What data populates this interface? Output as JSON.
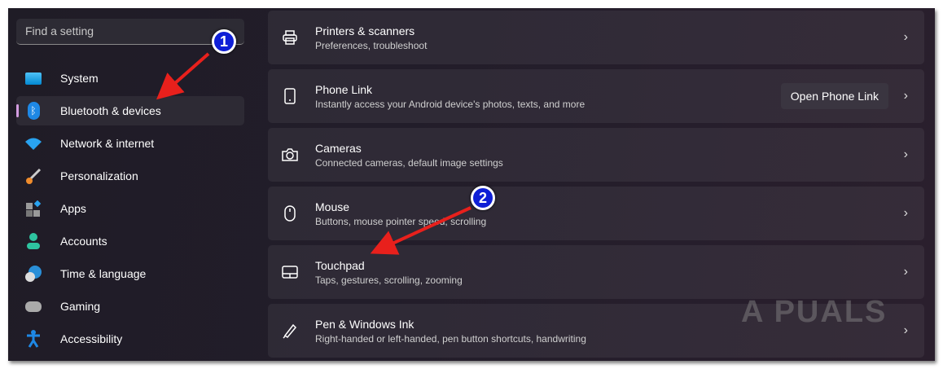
{
  "search": {
    "placeholder": "Find a setting"
  },
  "sidebar": {
    "items": [
      {
        "label": "System",
        "icon": "system-icon"
      },
      {
        "label": "Bluetooth & devices",
        "icon": "bluetooth-icon",
        "selected": true
      },
      {
        "label": "Network & internet",
        "icon": "wifi-icon"
      },
      {
        "label": "Personalization",
        "icon": "brush-icon"
      },
      {
        "label": "Apps",
        "icon": "apps-icon"
      },
      {
        "label": "Accounts",
        "icon": "person-icon"
      },
      {
        "label": "Time & language",
        "icon": "globe-clock-icon"
      },
      {
        "label": "Gaming",
        "icon": "gamepad-icon"
      },
      {
        "label": "Accessibility",
        "icon": "accessibility-icon"
      }
    ]
  },
  "cards": [
    {
      "title": "Printers & scanners",
      "subtitle": "Preferences, troubleshoot",
      "icon": "printer-icon"
    },
    {
      "title": "Phone Link",
      "subtitle": "Instantly access your Android device's photos, texts, and more",
      "icon": "phone-icon",
      "button": "Open Phone Link"
    },
    {
      "title": "Cameras",
      "subtitle": "Connected cameras, default image settings",
      "icon": "camera-icon"
    },
    {
      "title": "Mouse",
      "subtitle": "Buttons, mouse pointer speed, scrolling",
      "icon": "mouse-icon"
    },
    {
      "title": "Touchpad",
      "subtitle": "Taps, gestures, scrolling, zooming",
      "icon": "touchpad-icon"
    },
    {
      "title": "Pen & Windows Ink",
      "subtitle": "Right-handed or left-handed, pen button shortcuts, handwriting",
      "icon": "pen-icon"
    }
  ],
  "chevron": "›",
  "callouts": [
    "1",
    "2"
  ],
  "watermark": "A PUALS",
  "colors": {
    "accent": "#d39ce0",
    "callout": "#0f1fd6",
    "arrow": "#e8201c"
  }
}
